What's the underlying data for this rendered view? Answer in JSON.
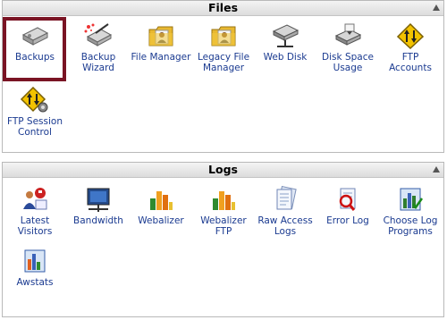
{
  "files": {
    "title": "Files",
    "items": [
      {
        "label": "Backups",
        "icon": "backup-drive-icon"
      },
      {
        "label": "Backup Wizard",
        "icon": "backup-wizard-icon"
      },
      {
        "label": "File Manager",
        "icon": "folder-person-icon"
      },
      {
        "label": "Legacy File Manager",
        "icon": "folder-person-icon"
      },
      {
        "label": "Web Disk",
        "icon": "network-drive-icon"
      },
      {
        "label": "Disk Space Usage",
        "icon": "disk-usage-icon"
      },
      {
        "label": "FTP Accounts",
        "icon": "ftp-arrows-icon"
      },
      {
        "label": "FTP Session Control",
        "icon": "ftp-gear-icon"
      }
    ]
  },
  "logs": {
    "title": "Logs",
    "items": [
      {
        "label": "Latest Visitors",
        "icon": "visitors-icon"
      },
      {
        "label": "Bandwidth",
        "icon": "bandwidth-monitor-icon"
      },
      {
        "label": "Webalizer",
        "icon": "webalizer-chart-icon"
      },
      {
        "label": "Webalizer FTP",
        "icon": "webalizer-chart-icon"
      },
      {
        "label": "Raw Access Logs",
        "icon": "log-pages-icon"
      },
      {
        "label": "Error Log",
        "icon": "error-log-icon"
      },
      {
        "label": "Choose Log Programs",
        "icon": "choose-log-icon"
      },
      {
        "label": "Awstats",
        "icon": "awstats-icon"
      }
    ]
  },
  "colors": {
    "selected_border": "#7a1424",
    "link": "#1a3a90"
  }
}
